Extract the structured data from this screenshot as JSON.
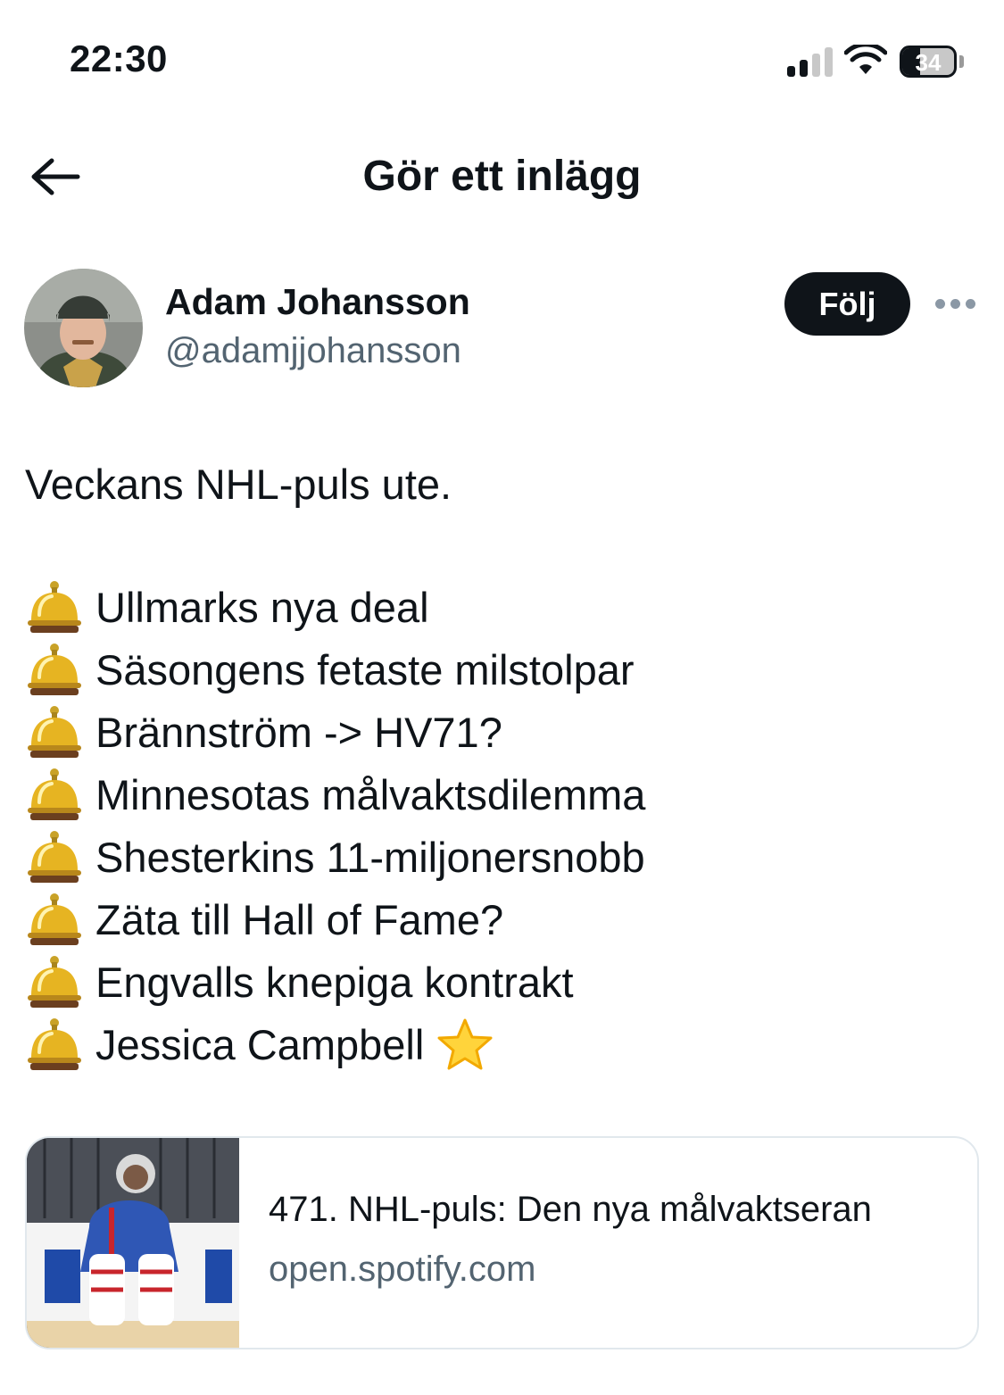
{
  "status_bar": {
    "time": "22:30",
    "battery_percent": "34",
    "signal_bars_active": 2,
    "signal_bars_total": 4
  },
  "header": {
    "title": "Gör ett inlägg",
    "back_icon": "arrow-left-icon"
  },
  "author": {
    "name": "Adam Johansson",
    "handle": "@adamjjohansson",
    "follow_label": "Följ",
    "more_icon": "ellipsis-icon"
  },
  "post": {
    "text": "Veckans NHL-puls ute.",
    "bullet_icon": "bellhop-bell-icon",
    "items": [
      "Ullmarks nya deal",
      "Säsongens fetaste milstolpar",
      "Brännström -> HV71?",
      "Minnesotas målvaktsdilemma",
      "Shesterkins 11-miljonersnobb",
      "Zäta till Hall of Fame?",
      "Engvalls knepiga kontrakt",
      "Jessica Campbell"
    ],
    "last_item_icon": "star-icon"
  },
  "link_card": {
    "title": "471. NHL-puls: Den nya målvaktseran",
    "domain": "open.spotify.com",
    "thumbnail": "hockey-goalie-thumbnail"
  },
  "colors": {
    "text": "#0f1419",
    "secondary": "#536471",
    "follow_bg": "#0f1419",
    "card_border": "#e1e8ed"
  }
}
